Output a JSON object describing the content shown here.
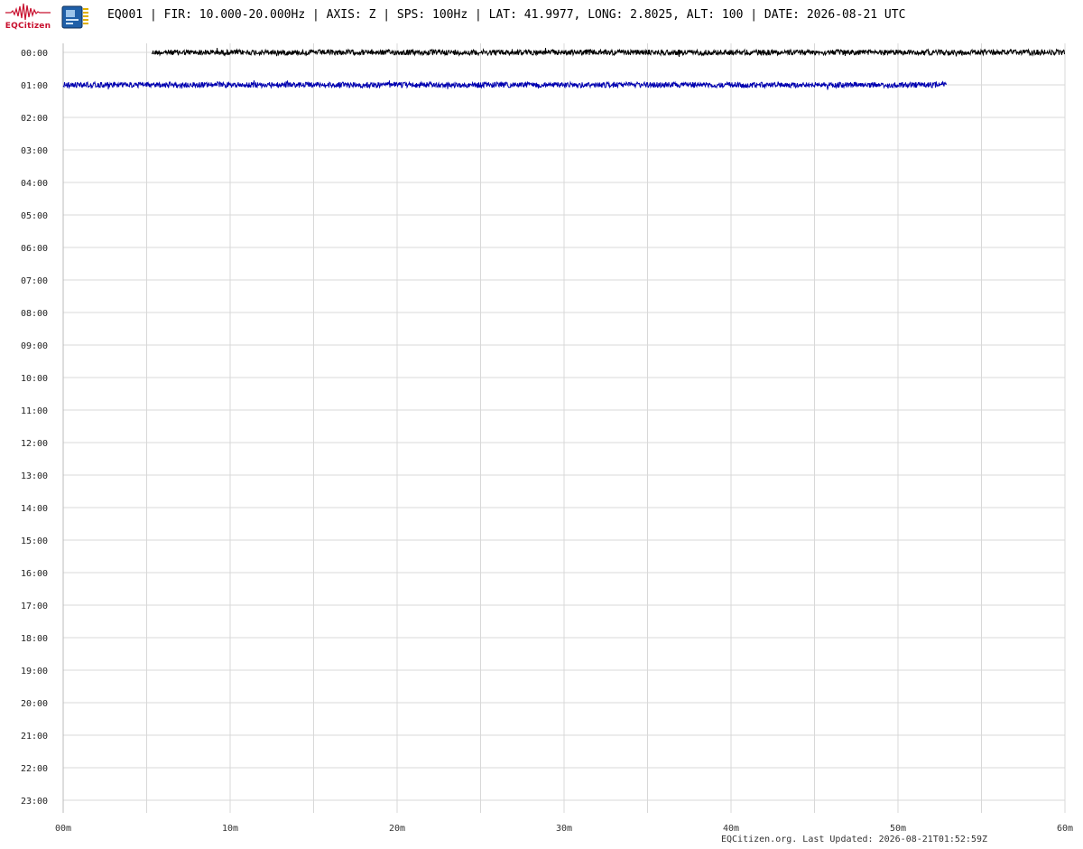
{
  "brand": {
    "logo_text": "EQCitizen"
  },
  "header": {
    "title": "EQ001 | FIR: 10.000-20.000Hz | AXIS: Z | SPS: 100Hz | LAT: 41.9977, LONG: 2.8025, ALT: 100 | DATE: 2026-08-21 UTC"
  },
  "footer": {
    "text": "EQCitizen.org. Last Updated: 2026-08-21T01:52:59Z"
  },
  "colors": {
    "trace_hour_0": "#000000",
    "trace_hour_1": "#0000b0",
    "grid": "#d8d8d8",
    "logo": "#c8102e"
  },
  "chart_data": {
    "type": "line",
    "title": "EQ001 | FIR: 10.000-20.000Hz | AXIS: Z | SPS: 100Hz | LAT: 41.9977, LONG: 2.8025, ALT: 100 | DATE: 2026-08-21 UTC",
    "xlabel": "",
    "ylabel": "",
    "x_unit": "minutes",
    "xlim": [
      0,
      60
    ],
    "x_ticks": [
      {
        "value": 0,
        "label": "00m"
      },
      {
        "value": 10,
        "label": "10m"
      },
      {
        "value": 20,
        "label": "20m"
      },
      {
        "value": 30,
        "label": "30m"
      },
      {
        "value": 40,
        "label": "40m"
      },
      {
        "value": 50,
        "label": "50m"
      },
      {
        "value": 60,
        "label": "60m"
      }
    ],
    "x_minor_step": 5,
    "rows": [
      "00:00",
      "01:00",
      "02:00",
      "03:00",
      "04:00",
      "05:00",
      "06:00",
      "07:00",
      "08:00",
      "09:00",
      "10:00",
      "11:00",
      "12:00",
      "13:00",
      "14:00",
      "15:00",
      "16:00",
      "17:00",
      "18:00",
      "19:00",
      "20:00",
      "21:00",
      "22:00",
      "23:00"
    ],
    "grid": true,
    "series": [
      {
        "row": "00:00",
        "start_min": 5.3,
        "end_min": 60,
        "color": "#000000"
      },
      {
        "row": "01:00",
        "start_min": 0,
        "end_min": 52.9,
        "color": "#0000b0"
      }
    ]
  }
}
